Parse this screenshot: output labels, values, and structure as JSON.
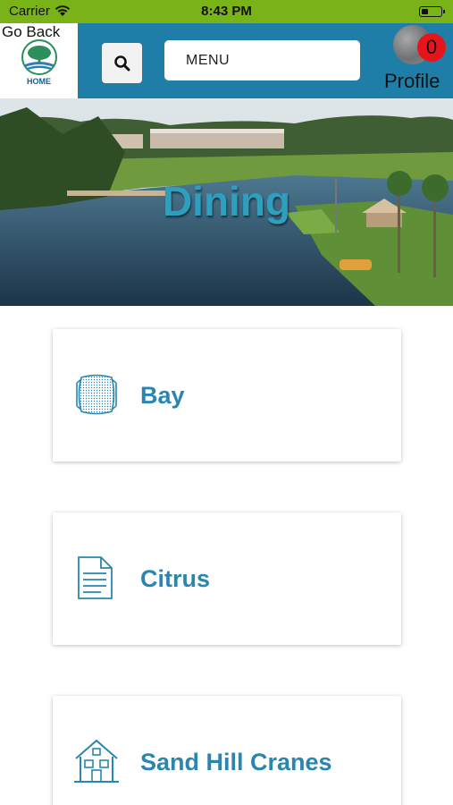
{
  "status_bar": {
    "carrier": "Carrier",
    "time": "8:43 PM"
  },
  "header": {
    "go_back": "Go Back",
    "home_label": "HOME",
    "menu_label": "MENU",
    "profile_label": "Profile",
    "notification_count": "0"
  },
  "hero": {
    "title": "Dining"
  },
  "cards": [
    {
      "label": "Bay",
      "icon": "cushion-icon"
    },
    {
      "label": "Citrus",
      "icon": "document-icon"
    },
    {
      "label": "Sand Hill Cranes",
      "icon": "house-icon"
    }
  ],
  "colors": {
    "status_bar": "#7ab317",
    "header": "#1f7ea8",
    "accent": "#2a86b0",
    "badge": "#e8141b"
  }
}
